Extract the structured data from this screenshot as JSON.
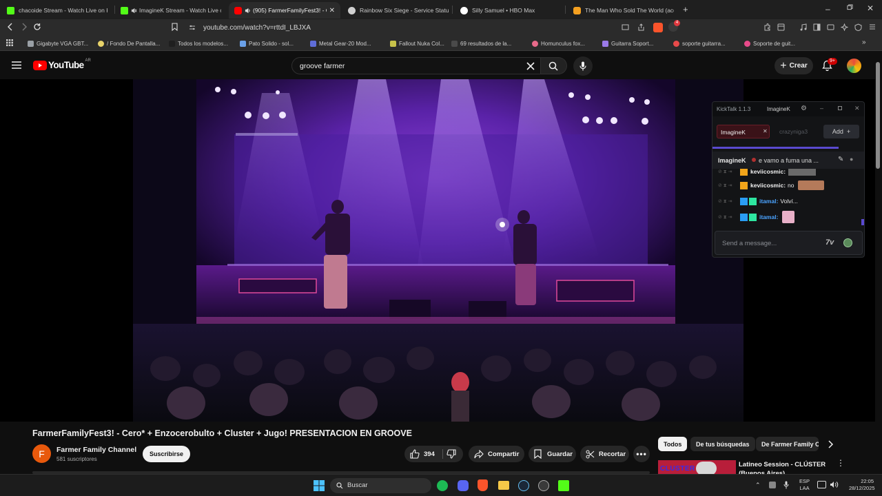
{
  "browser": {
    "tabs": [
      {
        "title": "chacoide Stream - Watch Live on Kick",
        "favicon_color": "#53fc18"
      },
      {
        "title": "ImagineK Stream - Watch Live on",
        "favicon_color": "#53fc18"
      },
      {
        "title": "(905) FarmerFamilyFest3! - Ce",
        "favicon_color": "#ff0000"
      },
      {
        "title": "Rainbow Six Siege - Service Status | U",
        "favicon_color": "#cfcfcf"
      },
      {
        "title": "Silly Samuel • HBO Max",
        "favicon_color": "#ffffff"
      },
      {
        "title": "The Man Who Sold The World (acon",
        "favicon_color": "#f4a020"
      }
    ],
    "url": "youtube.com/watch?v=rttdI_LBJXA",
    "bookmarks": [
      {
        "label": "Gigabyte VGA GBT...",
        "color": "#9aa0a6"
      },
      {
        "label": "/ Fondo De Pantalla...",
        "color": "#e8d36a"
      },
      {
        "label": "Todos los modelos...",
        "color": "#1f1f1f"
      },
      {
        "label": "Pato Solido - sol...",
        "color": "#6aa0e8"
      },
      {
        "label": "Metal Gear-20 Mod...",
        "color": "#5f6dd8"
      },
      {
        "label": "Fallout Nuka Col...",
        "color": "#c7c24a"
      },
      {
        "label": "69 resultados de la...",
        "color": "#4a4a4a"
      },
      {
        "label": "Homunculus fox...",
        "color": "#e86a8a"
      },
      {
        "label": "Guitarra Soport...",
        "color": "#9a7ae8"
      },
      {
        "label": "soporte guitarra...",
        "color": "#e84a4a"
      },
      {
        "label": "Soporte de guit...",
        "color": "#e84a8a"
      }
    ],
    "brave_badge": "4"
  },
  "youtube": {
    "logo_text": "YouTube",
    "country": "AR",
    "search_query": "groove farmer",
    "create_label": "Crear",
    "notif_count": "9+",
    "video_title": "FarmerFamilyFest3! - Cero* + Enzocerobulto + Cluster + Jugo! PRESENTACION EN GROOVE",
    "channel_initial": "F",
    "channel_name": "Farmer Family Channel",
    "subscribers": "581 suscriptores",
    "subscribe_label": "Suscribirse",
    "like_count": "394",
    "share_label": "Compartir",
    "save_label": "Guardar",
    "clip_label": "Recortar",
    "chips": [
      "Todos",
      "De tus búsquedas",
      "De Farmer Family C"
    ],
    "suggested": {
      "title": "Latineo Session - CLÚSTER",
      "subtitle": "(Buenos Aires)",
      "thumb_text": "CLUSTER"
    }
  },
  "kicktalk": {
    "app_title": "KickTalk 1.1.3",
    "user": "ImagineK",
    "active_tab": "ImagineK",
    "inactive_tab": "crazyniga3",
    "add_label": "Add",
    "pinned_user": "ImagineK",
    "pinned_text": "e vamo a fuma una ...",
    "messages": [
      {
        "user": "keviicosmic:",
        "text": "",
        "color": "#f2c14e"
      },
      {
        "user": "keviicosmic:",
        "text": "no",
        "color": "#f2c14e"
      },
      {
        "user": "itamal:",
        "text": "Volví...",
        "color": "#4aa3ff"
      },
      {
        "user": "itamal:",
        "text": "",
        "color": "#4aa3ff"
      }
    ],
    "input_placeholder": "Send a message..."
  },
  "taskbar": {
    "search_label": "Buscar",
    "lang": "ESP",
    "layout": "LAA",
    "time": "22:05",
    "date": "28/12/2025"
  }
}
